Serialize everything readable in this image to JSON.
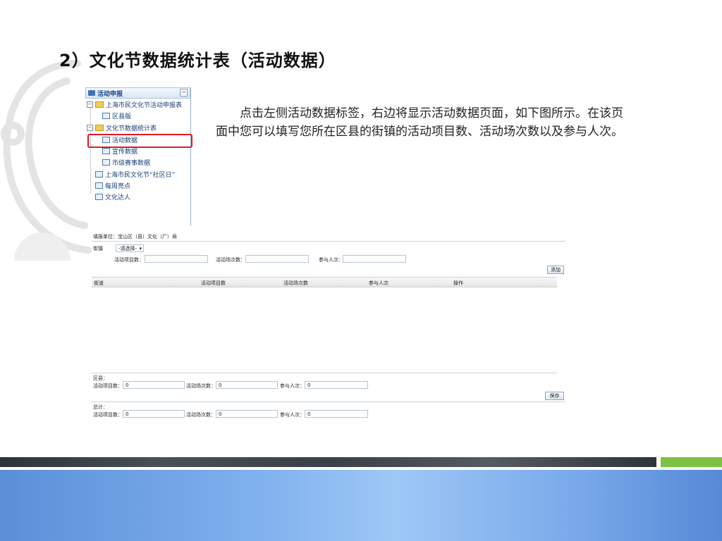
{
  "title": "2）文化节数据统计表（活动数据）",
  "tree": {
    "header": "活动申报",
    "collapse_icon": "−",
    "items": [
      {
        "label": "上海市民文化节活动申报表",
        "kind": "folder"
      },
      {
        "label": "区县版",
        "kind": "page"
      },
      {
        "label": "文化节数据统计表",
        "kind": "folder"
      },
      {
        "label": "活动数据",
        "kind": "page",
        "selected": true
      },
      {
        "label": "宣传数据",
        "kind": "page"
      },
      {
        "label": "市级赛事数据",
        "kind": "page"
      },
      {
        "label": "上海市民文化节“社区日”",
        "kind": "page"
      },
      {
        "label": "每周亮点",
        "kind": "page"
      },
      {
        "label": "文化达人",
        "kind": "page"
      }
    ]
  },
  "description": "点击左侧活动数据标签，右边将显示活动数据页面，如下图所示。在该页面中您可以填写您所在区县的街镇的活动项目数、活动场次数以及参与人次。",
  "form": {
    "unit_label": "填报单位：宝山区（县）文化（广）局",
    "street_label": "街镇",
    "street_select": "-请选择-",
    "activity_items_label": "活动项目数：",
    "activity_sessions_label": "活动场次数：",
    "participants_label": "参与人次：",
    "add_button": "添加",
    "columns": [
      "街道",
      "活动项目数",
      "活动场次数",
      "参与人次",
      "操作"
    ],
    "district_label": "区县：",
    "district_values": [
      "0",
      "0",
      "0"
    ],
    "save_button": "保存",
    "total_label": "总计：",
    "total_values": [
      "0",
      "0",
      "0"
    ]
  },
  "colors": {
    "highlight_border": "#e01b24",
    "footer_green": "#7cc244",
    "footer_blue": "#7fb0ee"
  }
}
